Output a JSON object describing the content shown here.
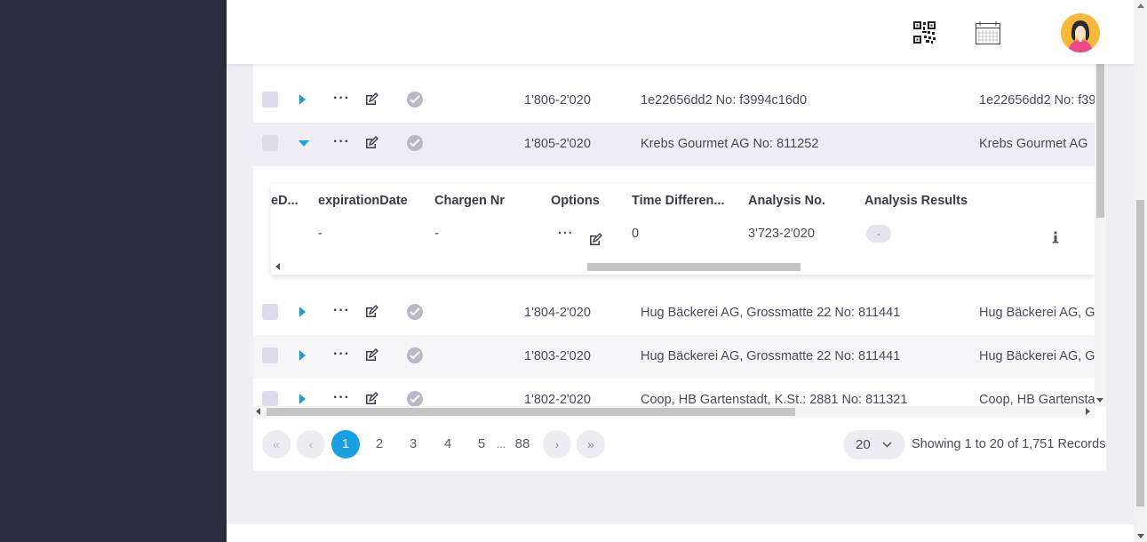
{
  "header": {
    "qr_icon": "qr-code-icon",
    "calendar_icon": "calendar-icon",
    "avatar_icon": "user-avatar"
  },
  "table": {
    "rows": [
      {
        "id": "1'806-2'020",
        "customer": "1e22656dd2 No: f3994c16d0",
        "customer2": "1e22656dd2 No: f39"
      },
      {
        "id": "1'805-2'020",
        "customer": "Krebs Gourmet AG No: 811252",
        "customer2": "Krebs Gourmet AG"
      },
      {
        "id": "1'804-2'020",
        "customer": "Hug Bäckerei AG, Grossmatte 22 No: 811441",
        "customer2": "Hug Bäckerei AG, G"
      },
      {
        "id": "1'803-2'020",
        "customer": "Hug Bäckerei AG, Grossmatte 22 No: 811441",
        "customer2": "Hug Bäckerei AG, G"
      },
      {
        "id": "1'802-2'020",
        "customer": "Coop, HB Gartenstadt, K.St.: 2881 No: 811321",
        "customer2": "Coop, HB Gartensta"
      }
    ]
  },
  "nested": {
    "headers": {
      "col0": "eD...",
      "expiration": "expirationDate",
      "chargen": "Chargen Nr",
      "options": "Options",
      "time_diff": "Time Differen...",
      "analysis_no": "Analysis No.",
      "analysis_results": "Analysis Results"
    },
    "row": {
      "expiration": "-",
      "chargen": "-",
      "time_diff": "0",
      "analysis_no": "3'723-2'020",
      "analysis_result_badge": "-"
    }
  },
  "pagination": {
    "first": "«",
    "prev": "‹",
    "pages": [
      "1",
      "2",
      "3",
      "4",
      "5"
    ],
    "ellipsis": "...",
    "last_page": "88",
    "next": "›",
    "last": "»",
    "page_size": "20",
    "summary": "Showing 1 to 20 of 1,751 Records"
  },
  "colors": {
    "sidebar": "#2b2d3e",
    "accent": "#1aa0e0"
  }
}
